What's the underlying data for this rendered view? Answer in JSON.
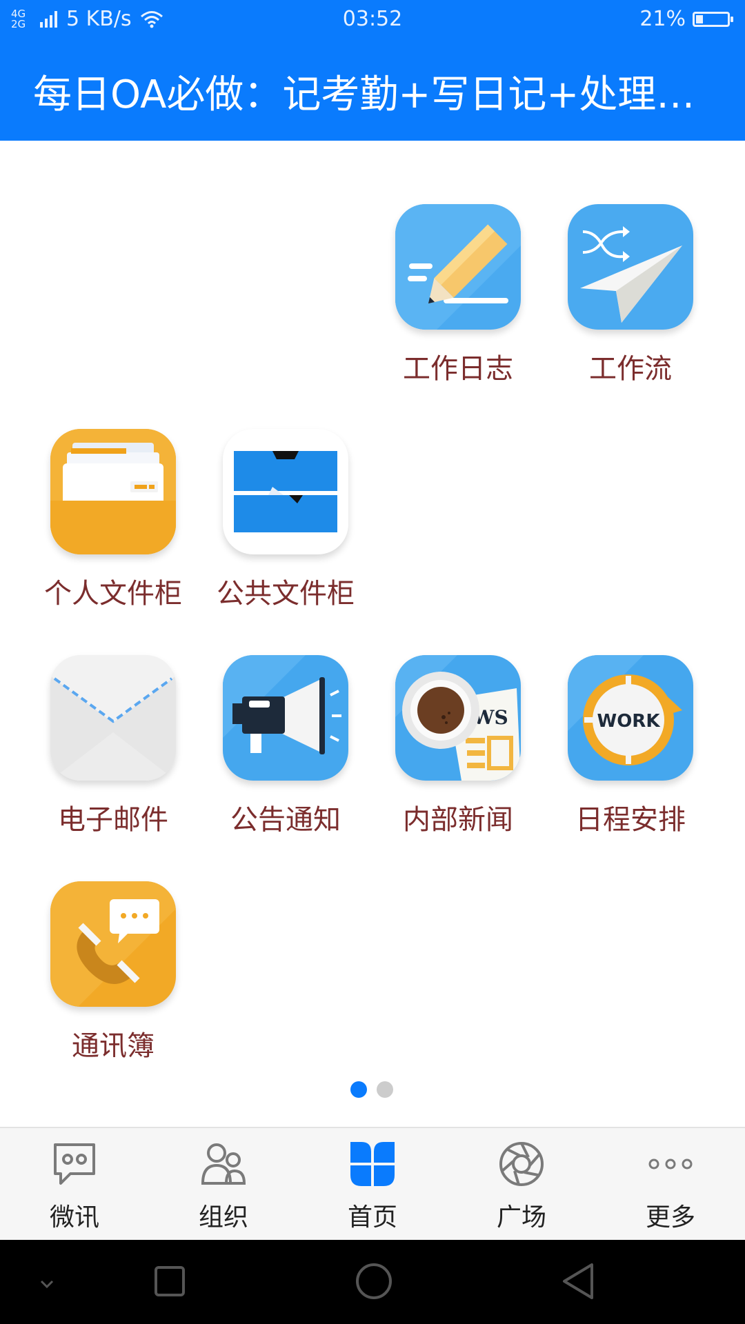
{
  "status_bar": {
    "network_type": "4G 2G",
    "speed": "5 KB/s",
    "time": "03:52",
    "battery_percent": "21%",
    "battery_level": 0.21
  },
  "header": {
    "title": "每日OA必做：记考勤+写日记+处理…"
  },
  "apps": [
    {
      "label": "工作日志",
      "icon": "pencil-journal-icon"
    },
    {
      "label": "工作流",
      "icon": "paper-plane-icon"
    },
    {
      "label": "个人文件柜",
      "icon": "personal-file-cabinet-icon"
    },
    {
      "label": "公共文件柜",
      "icon": "public-file-cabinet-icon"
    },
    {
      "label": "电子邮件",
      "icon": "envelope-icon"
    },
    {
      "label": "公告通知",
      "icon": "megaphone-icon"
    },
    {
      "label": "内部新闻",
      "icon": "coffee-news-icon"
    },
    {
      "label": "日程安排",
      "icon": "work-clock-icon",
      "badge_text": "WORK"
    },
    {
      "label": "通讯簿",
      "icon": "phone-book-icon"
    }
  ],
  "pager": {
    "current_page": 1,
    "total_pages": 2
  },
  "tabs": [
    {
      "label": "微讯",
      "icon": "chat-bubble-icon",
      "active": false
    },
    {
      "label": "组织",
      "icon": "people-icon",
      "active": false
    },
    {
      "label": "首页",
      "icon": "home-grid-icon",
      "active": true
    },
    {
      "label": "广场",
      "icon": "aperture-icon",
      "active": false
    },
    {
      "label": "更多",
      "icon": "more-dots-icon",
      "active": false
    }
  ],
  "colors": {
    "brand": "#0a7bfd",
    "label_text": "#7b2d2d",
    "icon_blue": "#45a7ee",
    "icon_orange": "#f0a51e",
    "pager_inactive": "#cccccc"
  }
}
